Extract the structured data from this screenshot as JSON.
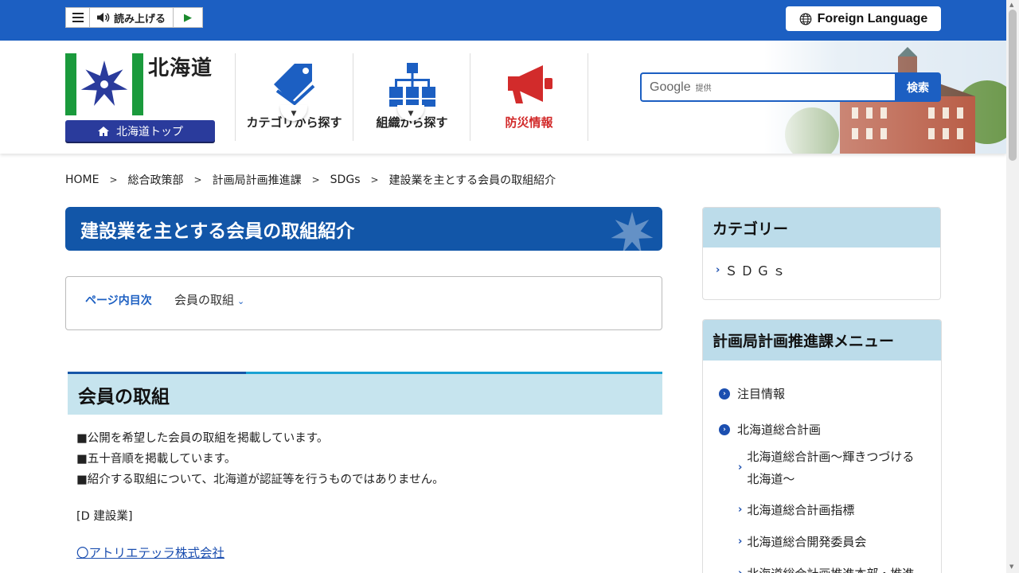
{
  "topbar": {
    "speak_label": "読み上げる",
    "foreign_label": "Foreign Language"
  },
  "header": {
    "logo_text": "北海道",
    "top_button": "北海道トップ",
    "nav": [
      {
        "label": "カテゴリから探す"
      },
      {
        "label": "組織から探す"
      },
      {
        "label": "防災情報"
      }
    ],
    "search": {
      "google_label": "Google",
      "provided_label": "提供",
      "button_label": "検索"
    }
  },
  "breadcrumb": [
    "HOME",
    "総合政策部",
    "計画局計画推進課",
    "SDGs",
    "建設業を主とする会員の取組紹介"
  ],
  "main": {
    "title": "建設業を主とする会員の取組紹介",
    "toc_lead": "ページ内目次",
    "toc_link": "会員の取組",
    "section_heading": "会員の取組",
    "notes": [
      "■公開を希望した会員の取組を掲載しています。",
      "■五十音順を掲載しています。",
      "■紹介する取組について、北海道が認証等を行うものではありません。"
    ],
    "category_label": "[D 建設業]",
    "member_link": "〇アトリエテッラ株式会社"
  },
  "sidebar": {
    "category_heading": "カテゴリー",
    "category_item": "ＳＤＧｓ",
    "menu_heading": "計画局計画推進課メニュー",
    "menu": [
      {
        "label": "注目情報",
        "level": 1
      },
      {
        "label": "北海道総合計画",
        "level": 1
      },
      {
        "label": "北海道総合計画～輝きつづける北海道～",
        "level": 2
      },
      {
        "label": "北海道総合計画指標",
        "level": 2
      },
      {
        "label": "北海道総合開発委員会",
        "level": 2
      },
      {
        "label": "北海道総合計画推進本部・推進",
        "level": 2
      }
    ]
  },
  "colors": {
    "brand_blue": "#1c5fc2",
    "title_blue": "#1256a8",
    "heading_bg": "#c6e4ee",
    "sidebar_head_bg": "#bcdcea",
    "logo_green": "#1a9a3c",
    "disaster_red": "#d22b2b"
  }
}
